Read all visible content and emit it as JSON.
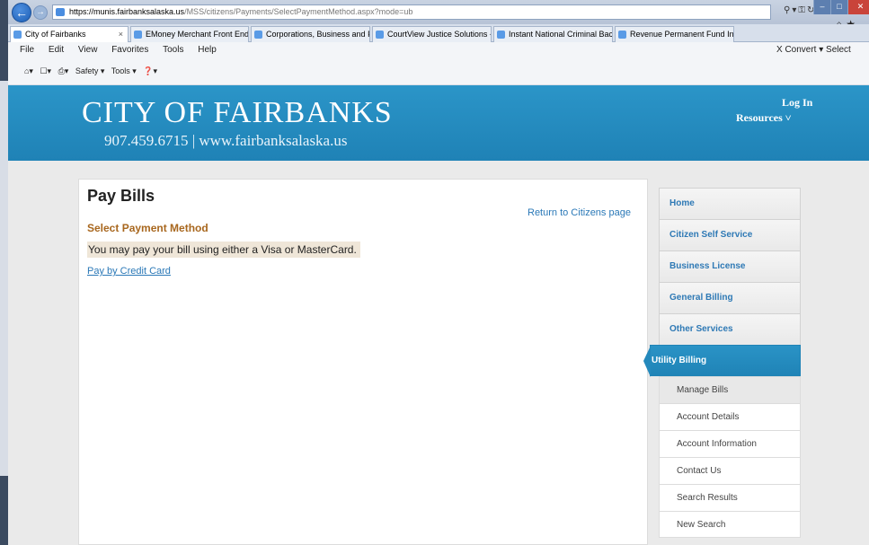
{
  "browser": {
    "address_host": "https://munis.fairbanksalaska.us",
    "address_path": "/MSS/citizens/Payments/SelectPaymentMethod.aspx?mode=ub",
    "tabs": [
      {
        "label": "City of Fairbanks"
      },
      {
        "label": "EMoney Merchant Front End"
      },
      {
        "label": "Corporations, Business and Pr..."
      },
      {
        "label": "CourtView Justice Solutions - c..."
      },
      {
        "label": "Instant National Criminal Back..."
      },
      {
        "label": "Revenue Permanent Fund Info..."
      }
    ],
    "menu": [
      "File",
      "Edit",
      "View",
      "Favorites",
      "Tools",
      "Help"
    ],
    "menu_right": "X   Convert ▾   Select",
    "cmd_safety": "Safety ▾",
    "cmd_tools": "Tools ▾"
  },
  "header": {
    "title": "CITY OF FAIRBANKS",
    "subtitle": "907.459.6715 | www.fairbanksalaska.us",
    "login": "Log In",
    "resources": "Resources"
  },
  "main": {
    "page_title": "Pay Bills",
    "return_link": "Return to Citizens page",
    "section_title": "Select Payment Method",
    "info_text": "You may pay your bill using either a Visa or MasterCard.",
    "pay_link": "Pay by Credit Card"
  },
  "sidenav": {
    "items": [
      {
        "label": "Home"
      },
      {
        "label": "Citizen Self Service"
      },
      {
        "label": "Business License"
      },
      {
        "label": "General Billing"
      },
      {
        "label": "Other Services"
      }
    ],
    "active": "Utility Billing",
    "sub_items": [
      {
        "label": "Manage Bills"
      },
      {
        "label": "Account Details"
      },
      {
        "label": "Account Information"
      },
      {
        "label": "Contact Us"
      },
      {
        "label": "Search Results"
      },
      {
        "label": "New Search"
      }
    ]
  },
  "colors": {
    "header_blue": "#2089bd",
    "link_blue": "#2a78b7",
    "section_orange": "#a8671e"
  }
}
